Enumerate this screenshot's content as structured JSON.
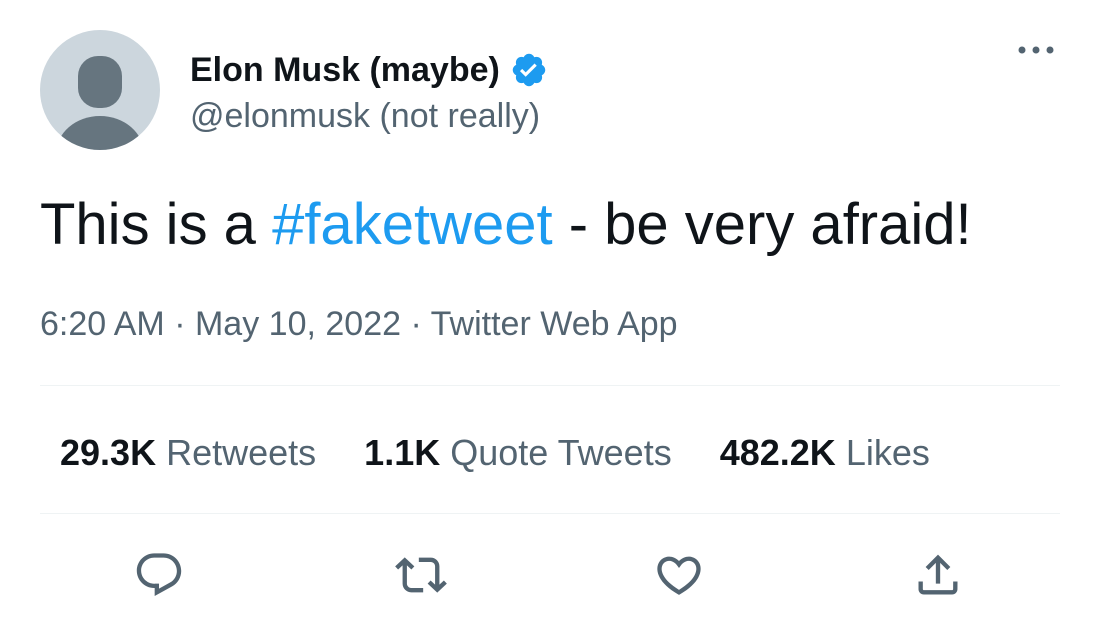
{
  "tweet": {
    "author": {
      "display_name": "Elon Musk (maybe)",
      "handle": "@elonmusk (not really)",
      "verified": true,
      "avatar_icon": "default-profile-icon"
    },
    "text_before": "This is a ",
    "hashtag": "#faketweet",
    "text_after": " - be very afraid!",
    "meta": {
      "time": "6:20 AM",
      "separator": "·",
      "date": "May 10, 2022",
      "source": "Twitter Web App"
    },
    "stats": [
      {
        "count": "29.3K",
        "label": "Retweets"
      },
      {
        "count": "1.1K",
        "label": "Quote Tweets"
      },
      {
        "count": "482.2K",
        "label": "Likes"
      }
    ],
    "actions": [
      {
        "icon": "reply-icon"
      },
      {
        "icon": "retweet-icon"
      },
      {
        "icon": "like-heart-icon"
      },
      {
        "icon": "share-icon"
      }
    ]
  },
  "colors": {
    "text_primary": "#0f1419",
    "text_secondary": "#536471",
    "accent": "#1d9bf0",
    "divider": "#eff3f4",
    "avatar_bg": "#ccd6dd"
  }
}
